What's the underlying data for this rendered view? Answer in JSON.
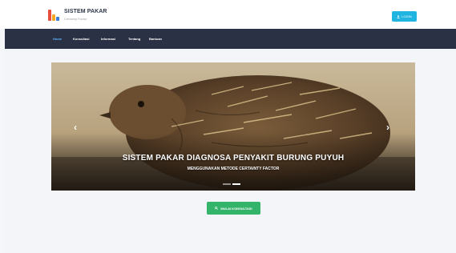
{
  "brand": {
    "title": "SISTEM PAKAR",
    "subtitle": "Certainty Factor"
  },
  "header": {
    "login_label": "LOGIN",
    "login_icon": "user-icon"
  },
  "nav": {
    "items": [
      {
        "label": "Home",
        "active": true
      },
      {
        "label": "Konsultasi",
        "active": false
      },
      {
        "label": "Informasi",
        "active": false
      },
      {
        "label": "Tentang",
        "active": false
      },
      {
        "label": "Bantuan",
        "active": false
      }
    ]
  },
  "carousel": {
    "title": "SISTEM PAKAR DIAGNOSA PENYAKIT BURUNG PUYUH",
    "subtitle": "MENGGUNAKAN METODE CERTAINTY FACTOR",
    "prev_icon": "chevron-left-icon",
    "next_icon": "chevron-right-icon",
    "slide_count": 2,
    "active_slide": 2
  },
  "cta": {
    "label": "MULAI KONSULTASI",
    "icon": "search-icon"
  },
  "colors": {
    "navbar": "#2b3144",
    "login_button": "#1fb5e0",
    "cta_button": "#34b36b",
    "nav_active": "#5ab4ff",
    "logo_bars": [
      "#e84c3d",
      "#f5a623",
      "#3a7bd5"
    ]
  }
}
